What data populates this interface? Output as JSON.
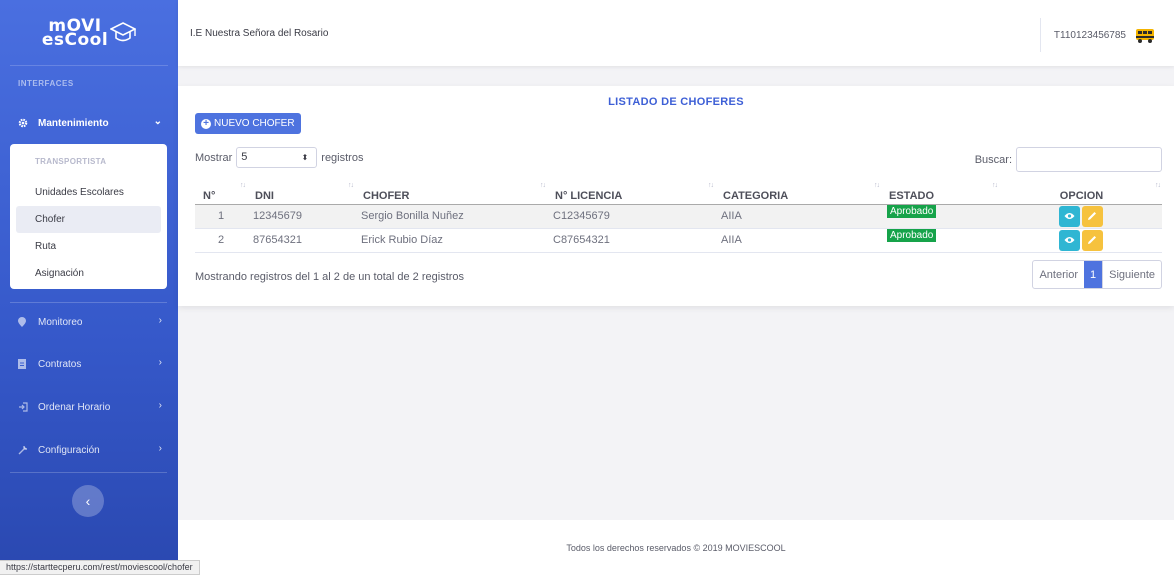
{
  "brand": {
    "line1": "mOVI",
    "line2": "esCool"
  },
  "sidebar": {
    "heading": "INTERFACES",
    "maintenance": {
      "label": "Mantenimiento"
    },
    "submenu": {
      "heading": "TRANSPORTISTA",
      "items": [
        "Unidades Escolares",
        "Chofer",
        "Ruta",
        "Asignación"
      ],
      "selected": "Chofer"
    },
    "items": [
      {
        "label": "Monitoreo",
        "icon": "map-marker-icon"
      },
      {
        "label": "Contratos",
        "icon": "document-icon"
      },
      {
        "label": "Ordenar Horario",
        "icon": "sign-in-icon"
      },
      {
        "label": "Configuración",
        "icon": "wrench-icon"
      }
    ]
  },
  "topbar": {
    "school": "I.E Nuestra Señora del Rosario",
    "user_code": "T110123456785"
  },
  "card": {
    "title": "LISTADO DE CHOFERES",
    "new_button": "NUEVO CHOFER",
    "show_label": "Mostrar",
    "show_value": "5",
    "records_label": "registros",
    "search_label": "Buscar:",
    "search_value": ""
  },
  "table": {
    "headers": [
      "N°",
      "DNI",
      "CHOFER",
      "N° LICENCIA",
      "CATEGORIA",
      "ESTADO",
      "OPCION"
    ],
    "rows": [
      [
        "1",
        "12345679",
        "Sergio Bonilla Nuñez",
        "C12345679",
        "AIIA",
        "Aprobado"
      ],
      [
        "2",
        "87654321",
        "Erick Rubio Díaz",
        "C87654321",
        "AIIA",
        "Aprobado"
      ]
    ]
  },
  "info": "Mostrando registros del 1 al 2 de un total de 2 registros",
  "pager": {
    "prev": "Anterior",
    "current": "1",
    "next": "Siguiente"
  },
  "footer": "Todos los derechos reservados © 2019 MOVIESCOOL",
  "status_url": "https://starttecperu.com/rest/moviescool/chofer",
  "colors": {
    "primary": "#4e73df",
    "success": "#16a34a",
    "info": "#2fb6d3",
    "warning": "#f6c23e"
  }
}
